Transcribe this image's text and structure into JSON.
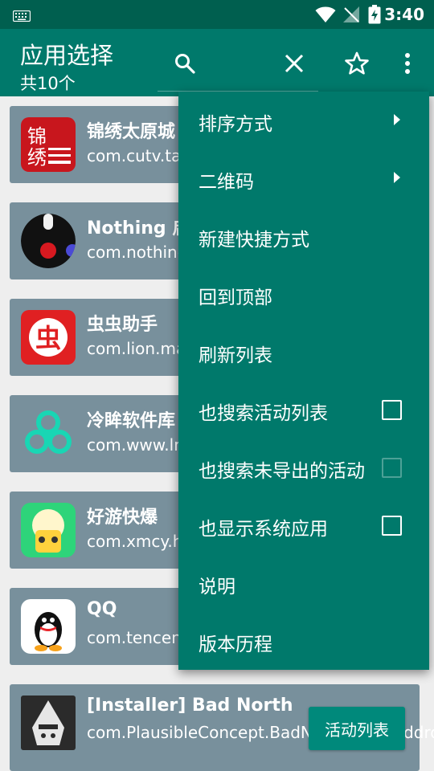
{
  "status_bar": {
    "time": "3:40",
    "icons": [
      "keyboard-icon",
      "wifi-icon",
      "no-signal-icon",
      "battery-charging-icon"
    ]
  },
  "app_bar": {
    "title": "应用选择",
    "subtitle": "共10个",
    "actions": [
      "search-icon",
      "close-icon",
      "star-icon",
      "more-vert-icon"
    ]
  },
  "apps": [
    {
      "name": "锦绣太原城",
      "package": "com.cutv.tai"
    },
    {
      "name": "Nothing 启",
      "package": "com.nothing"
    },
    {
      "name": "虫虫助手",
      "package": "com.lion.ma"
    },
    {
      "name": "冷眸软件库",
      "package": "com.www.ln"
    },
    {
      "name": "好游快爆",
      "package": "com.xmcy.hy"
    },
    {
      "name": "QQ",
      "package": "com.tencent"
    },
    {
      "name": "[Installer] Bad North",
      "package": "com.PlausibleConcept.BadNorthFull.moddroid",
      "button": "活动列表"
    }
  ],
  "menu": {
    "items": [
      {
        "label": "排序方式",
        "submenu": true
      },
      {
        "label": "二维码",
        "submenu": true
      },
      {
        "label": "新建快捷方式"
      },
      {
        "label": "回到顶部"
      },
      {
        "label": "刷新列表"
      },
      {
        "label": "也搜索活动列表",
        "checkbox": true,
        "checked": false
      },
      {
        "label": "也搜索未导出的活动",
        "checkbox": true,
        "checked": false,
        "disabled": true
      },
      {
        "label": "也显示系统应用",
        "checkbox": true,
        "checked": false
      },
      {
        "label": "说明"
      },
      {
        "label": "版本历程"
      }
    ]
  },
  "colors": {
    "primary": "#00796b",
    "status_bar": "#005f4f",
    "card": "#78909c",
    "button": "#00897b"
  }
}
